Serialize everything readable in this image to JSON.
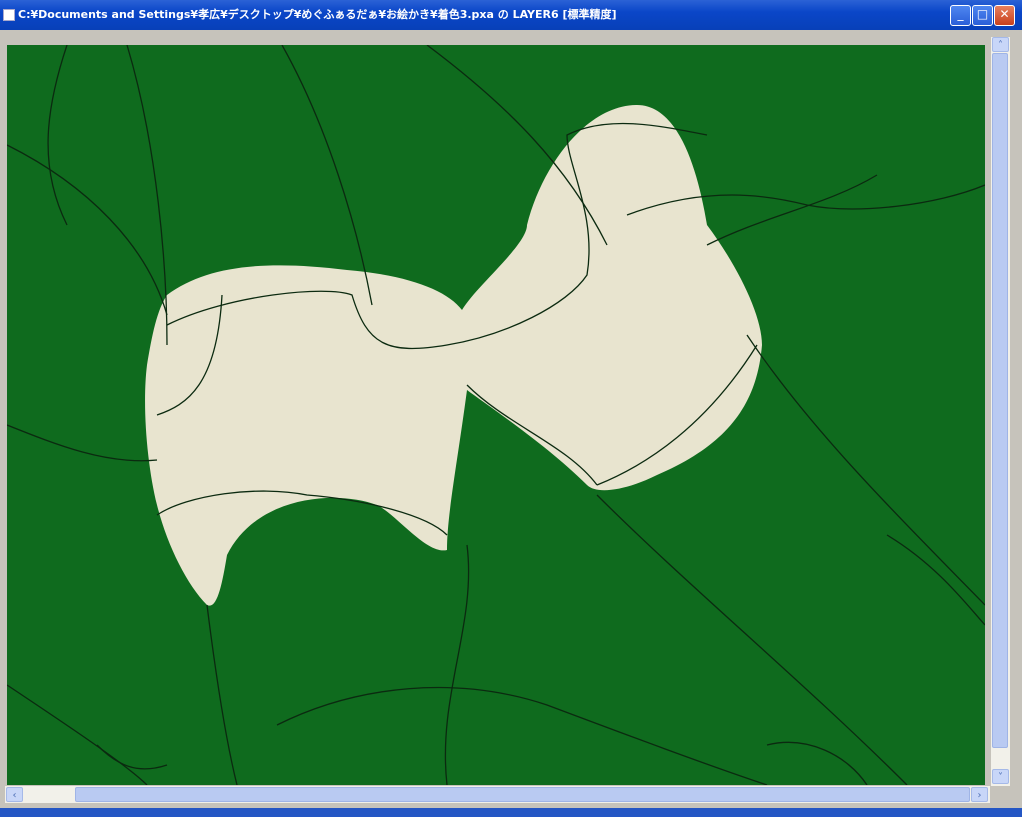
{
  "window": {
    "title": "C:¥Documents and Settings¥孝広¥デスクトップ¥めぐふぁるだぁ¥お絵かき¥着色3.pxa の LAYER6 [標準精度]"
  },
  "buttons": {
    "minimize": "_",
    "maximize": "□",
    "close": "✕"
  },
  "scroll": {
    "up": "˄",
    "down": "˅",
    "left": "‹",
    "right": "›"
  },
  "colors": {
    "canvas": "#0f6b1e",
    "fill": "#e8e4cf",
    "line": "#0b2a10"
  }
}
